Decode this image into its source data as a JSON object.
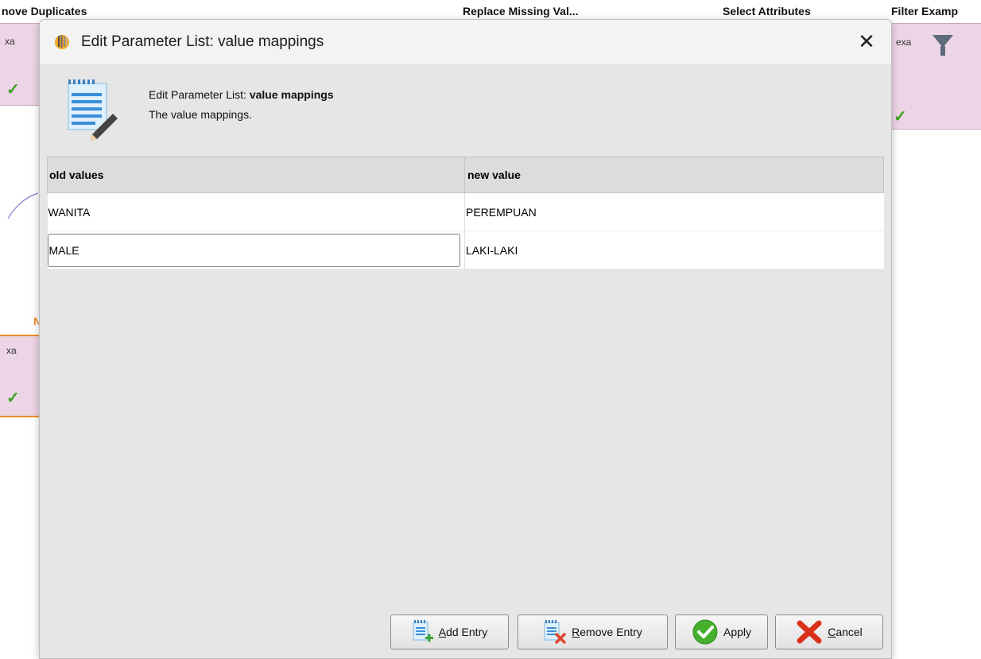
{
  "background": {
    "headers": [
      "nove Duplicates",
      "Replace Missing Val...",
      "Select Attributes",
      "Filter Examp"
    ],
    "port_label": "exa",
    "side_port_labels": [
      "xa",
      "xa"
    ],
    "orange_marker": "N"
  },
  "dialog": {
    "window_title": "Edit Parameter List: value mappings",
    "header_prefix": "Edit Parameter List: ",
    "header_param": "value mappings",
    "header_description": "The value mappings."
  },
  "table": {
    "columns": [
      "old values",
      "new value"
    ],
    "rows": [
      {
        "old": "WANITA",
        "new": "PEREMPUAN"
      },
      {
        "old": "MALE",
        "new": "LAKI-LAKI"
      }
    ]
  },
  "buttons": {
    "add_entry_mnemonic": "A",
    "add_entry_rest": "dd Entry",
    "remove_entry_mnemonic": "R",
    "remove_entry_rest": "emove Entry",
    "apply": "Apply",
    "cancel_mnemonic": "C",
    "cancel_rest": "ancel"
  },
  "colors": {
    "operator_fill": "#ecd5e6",
    "check_green": "#39a31f",
    "dialog_bg": "#e6e6e6",
    "selection_orange": "#f08a2a"
  },
  "icons": [
    "app-logo-icon",
    "close-icon",
    "edit-list-icon",
    "add-entry-icon",
    "remove-entry-icon",
    "apply-check-icon",
    "cancel-x-icon",
    "filter-funnel-icon",
    "checkmark-icon"
  ]
}
